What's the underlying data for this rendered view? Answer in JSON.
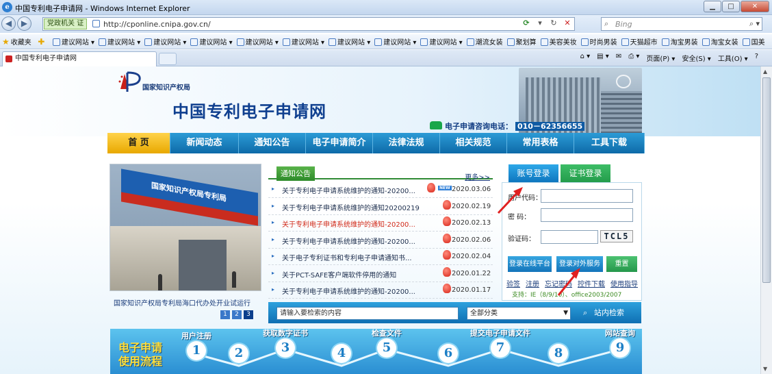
{
  "browser": {
    "title": "中国专利电子申请网 - Windows Internet Explorer",
    "compat_label": "党政机关",
    "compat_badge": "证",
    "url": "http://cponline.cnipa.gov.cn/",
    "search_placeholder": "Bing",
    "favorites_label": "收藏夹",
    "favorites": [
      "建议网站",
      "建议网站",
      "建议网站",
      "建议网站",
      "建议网站",
      "建议网站",
      "建议网站",
      "建议网站",
      "建议网站",
      "潮流女装",
      "聚划算",
      "美容美妆",
      "时尚男装",
      "天猫超市",
      "淘宝男装",
      "淘宝女装",
      "国美"
    ],
    "tab_title": "中国专利电子申请网",
    "commands": {
      "page": "页面(P) ▾",
      "safety": "安全(S) ▾",
      "tools": "工具(O) ▾",
      "help": "?"
    }
  },
  "header": {
    "org": "国家知识产权局",
    "site_name": "中国专利电子申请网",
    "hotline_label": "电子申请咨询电话：",
    "hotline_number": "010－62356655"
  },
  "nav": [
    "首  页",
    "新闻动态",
    "通知公告",
    "电子申请简介",
    "法律法规",
    "相关规范",
    "常用表格",
    "工具下载"
  ],
  "photo": {
    "sign_text": "国家知识产权局专利局",
    "caption": "国家知识产权局专利局海口代办处开业试运行",
    "pages": [
      "1",
      "2",
      "3"
    ]
  },
  "notice": {
    "tab": "通知公告",
    "more": "更多>>",
    "items": [
      {
        "title": "关于专利电子申请系统维护的通知-20200...",
        "date": "2020.03.06",
        "red": false,
        "new": true
      },
      {
        "title": "关于专利电子申请系统维护的通知20200219",
        "date": "2020.02.19",
        "red": false,
        "new": false
      },
      {
        "title": "关于专利电子申请系统维护的通知-20200...",
        "date": "2020.02.13",
        "red": true,
        "new": false
      },
      {
        "title": "关于专利电子申请系统维护的通知-20200...",
        "date": "2020.02.06",
        "red": false,
        "new": false
      },
      {
        "title": "关于电子专利证书和专利电子申请通知书...",
        "date": "2020.02.04",
        "red": false,
        "new": false
      },
      {
        "title": "关于PCT-SAFE客户端软件停用的通知",
        "date": "2020.01.22",
        "red": false,
        "new": false
      },
      {
        "title": "关于专利电子申请系统维护的通知-20200...",
        "date": "2020.01.17",
        "red": false,
        "new": false
      }
    ],
    "new_badge": "NEW"
  },
  "login": {
    "tab_account": "账号登录",
    "tab_cert": "证书登录",
    "user_label": "用户代码：",
    "password_label": "密    码：",
    "captcha_label": "验证码：",
    "captcha_text": "TCL5",
    "btn_online": "登录在线平台",
    "btn_external": "登录对外服务",
    "btn_reset": "重置",
    "links": [
      "验签",
      "注册",
      "忘记密码",
      "控件下载",
      "使用指导"
    ],
    "support": "支持：IE（8/9/10）、office2003/2007"
  },
  "search": {
    "keyword_placeholder": "请输入要检索的内容",
    "category": "全部分类",
    "button": "站内检索"
  },
  "flow": {
    "title_line1": "电子申请",
    "title_line2": "使用流程",
    "steps": [
      {
        "num": "1",
        "label": "用户注册"
      },
      {
        "num": "2",
        "label": ""
      },
      {
        "num": "3",
        "label": "获取数字证书"
      },
      {
        "num": "4",
        "label": ""
      },
      {
        "num": "5",
        "label": "检查文件"
      },
      {
        "num": "6",
        "label": ""
      },
      {
        "num": "7",
        "label": "提交电子申请文件"
      },
      {
        "num": "8",
        "label": ""
      },
      {
        "num": "9",
        "label": "网站查询"
      }
    ]
  },
  "colors": {
    "nav_blue": "#0d6aa8",
    "home_gold": "#e8a800",
    "notice_green": "#2d8a2a",
    "annotation_red": "#e02020"
  }
}
